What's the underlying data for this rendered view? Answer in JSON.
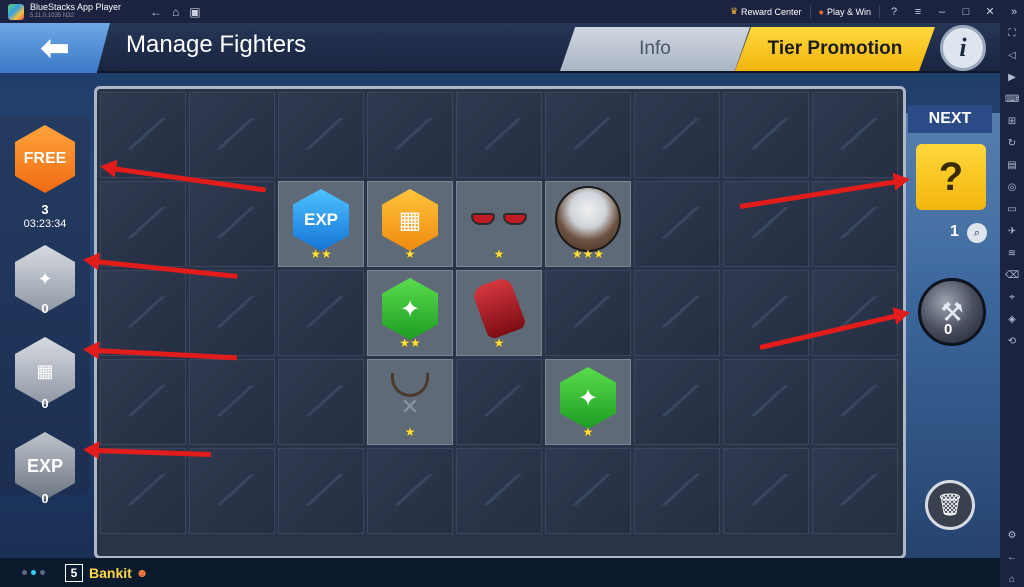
{
  "window": {
    "title": "BlueStacks App Player",
    "version": "5.11.0.1035 N32",
    "reward_center": "Reward Center",
    "play_win": "Play & Win"
  },
  "header": {
    "back_icon": "back-arrow-icon",
    "title": "Manage Fighters",
    "tab_info": "Info",
    "tab_tier": "Tier Promotion",
    "info_icon": "i"
  },
  "left_panel": {
    "free_label": "FREE",
    "free_count": "3",
    "free_timer": "03:23:34",
    "fighter_shard_count": "0",
    "vest_count": "0",
    "exp_label": "EXP",
    "exp_count": "0"
  },
  "grid": {
    "cells": [
      {
        "row": 1,
        "col": 2,
        "item": "EXP",
        "stars": "★★"
      },
      {
        "row": 1,
        "col": 3,
        "item": "vest",
        "stars": "★"
      },
      {
        "row": 1,
        "col": 4,
        "item": "sunglasses",
        "stars": "★"
      },
      {
        "row": 1,
        "col": 5,
        "item": "fighter-portrait",
        "stars": "★★★"
      },
      {
        "row": 2,
        "col": 3,
        "item": "green-shard",
        "stars": "★★"
      },
      {
        "row": 2,
        "col": 4,
        "item": "red-glove",
        "stars": "★"
      },
      {
        "row": 3,
        "col": 3,
        "item": "necklace",
        "stars": "★"
      },
      {
        "row": 3,
        "col": 5,
        "item": "green-shard",
        "stars": "★"
      }
    ]
  },
  "right_panel": {
    "next_label": "NEXT",
    "mystery_symbol": "?",
    "mystery_count": "1",
    "hammer_count": "0"
  },
  "bottom": {
    "level": "5",
    "player_name": "Bankit"
  },
  "colors": {
    "accent_yellow": "#f3b50c",
    "accent_blue": "#3a78c6",
    "arrow_red": "#e21b1b"
  }
}
